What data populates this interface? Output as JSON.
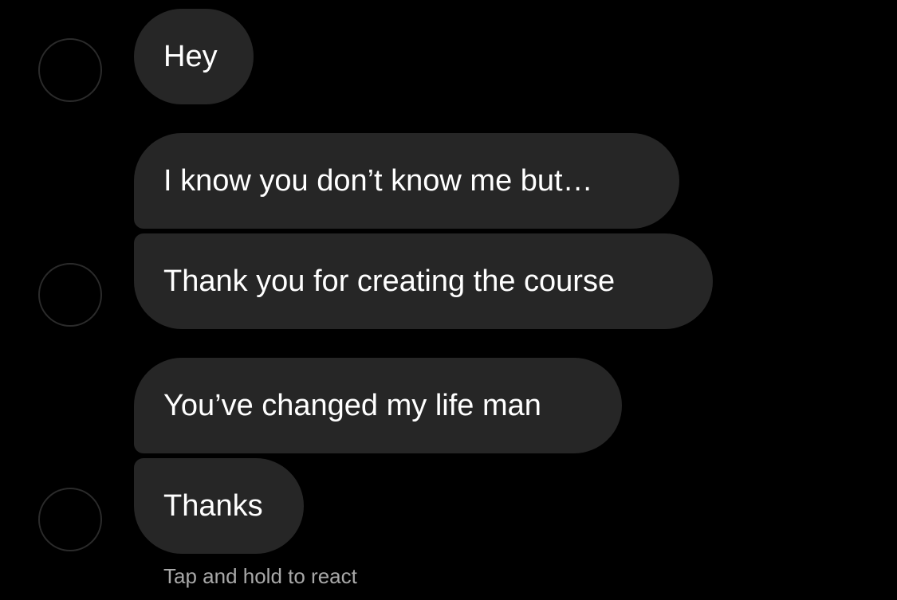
{
  "thread": {
    "messages": [
      {
        "text": "Hey"
      },
      {
        "text": "I know you don’t know me but…"
      },
      {
        "text": "Thank you for creating the course"
      },
      {
        "text": "You’ve changed my life man"
      },
      {
        "text": "Thanks"
      }
    ],
    "hint": "Tap and hold to react"
  },
  "colors": {
    "background": "#000000",
    "bubble": "#262626",
    "text": "#ffffff",
    "hint": "#a8a8a8"
  }
}
